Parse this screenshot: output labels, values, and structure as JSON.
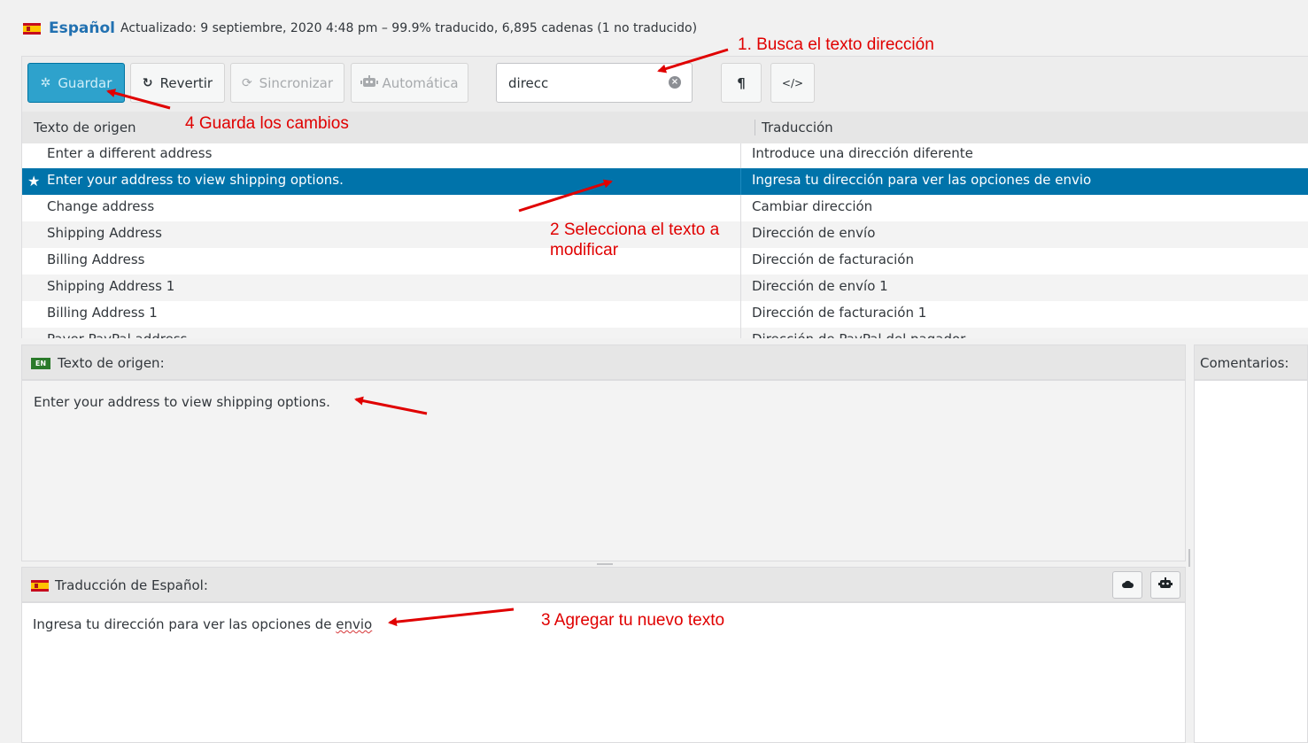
{
  "header": {
    "language": "Español",
    "info": "Actualizado: 9 septiembre, 2020 4:48 pm – 99.9% traducido, 6,895 cadenas (1 no traducido)"
  },
  "toolbar": {
    "save_label": "Guardar",
    "revert_label": "Revertir",
    "sync_label": "Sincronizar",
    "auto_label": "Automática",
    "search_value": "direcc",
    "invisibles_glyph": "¶",
    "code_glyph": "</>"
  },
  "list": {
    "col_source": "Texto de origen",
    "col_translation": "Traducción",
    "rows": [
      {
        "source": "Enter a different address",
        "translation": "Introduce una dirección diferente"
      },
      {
        "source": "Enter your address to view shipping options.",
        "translation": "Ingresa tu dirección para ver las opciones de envio",
        "selected": true
      },
      {
        "source": "Change address",
        "translation": "Cambiar dirección"
      },
      {
        "source": "Shipping Address",
        "translation": "Dirección de envío"
      },
      {
        "source": "Billing Address",
        "translation": "Dirección de facturación"
      },
      {
        "source": "Shipping Address 1",
        "translation": "Dirección de envío 1"
      },
      {
        "source": "Billing Address 1",
        "translation": "Dirección de facturación 1"
      },
      {
        "source": "Payer PayPal address",
        "translation": "Dirección de PayPal del pagador"
      }
    ]
  },
  "source_panel": {
    "badge": "EN",
    "label": "Texto de origen:",
    "text": "Enter your address to view shipping options."
  },
  "translation_panel": {
    "label": "Traducción de Español:",
    "text_main": "Ingresa tu dirección para ver las opciones de ",
    "text_misspelled": "envio"
  },
  "comments_panel": {
    "label": "Comentarios:"
  },
  "annotations": {
    "step1": "1. Busca el texto dirección",
    "step2_line1": "2 Selecciona el texto a",
    "step2_line2": "modificar",
    "step3": "3 Agregar tu nuevo texto",
    "step4": "4 Guarda los cambios"
  },
  "colors": {
    "primary_button": "#2ea2cc",
    "selected_row": "#0073aa",
    "annotation_red": "#e00000",
    "link_blue": "#2271b1"
  },
  "icons": {
    "save": "spinner-icon",
    "revert": "undo-icon",
    "sync": "sync-icon",
    "auto": "robot-icon",
    "clear": "clear-icon",
    "invisibles": "pilcrow-icon",
    "code": "code-icon",
    "star": "star-icon",
    "cloud": "cloud-icon"
  }
}
